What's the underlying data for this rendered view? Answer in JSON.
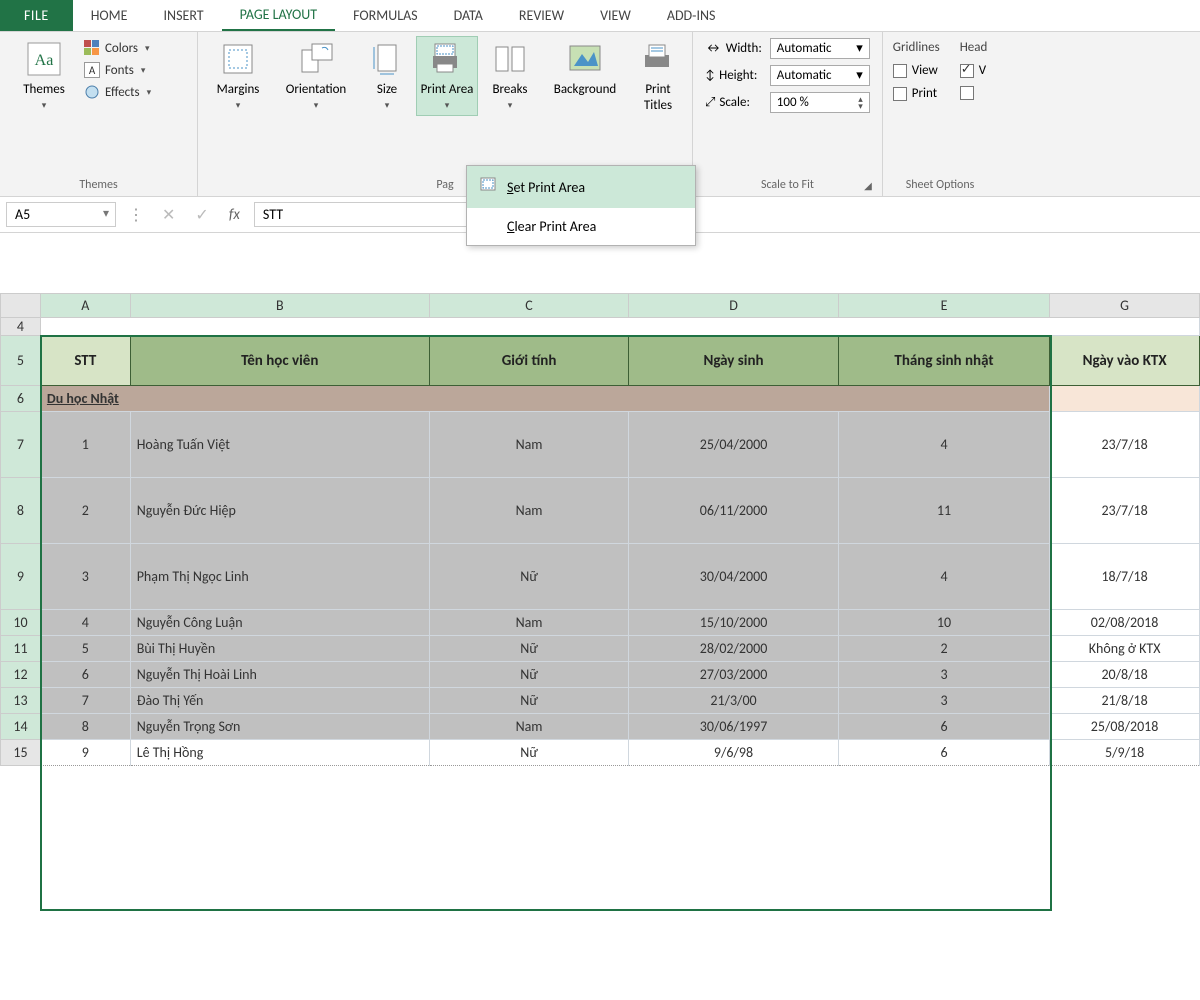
{
  "tabs": {
    "file": "FILE",
    "home": "HOME",
    "insert": "INSERT",
    "page_layout": "PAGE LAYOUT",
    "formulas": "FORMULAS",
    "data": "DATA",
    "review": "REVIEW",
    "view": "VIEW",
    "addins": "ADD-INS"
  },
  "ribbon": {
    "themes": {
      "label": "Themes",
      "btn": "Themes",
      "colors": "Colors",
      "fonts": "Fonts",
      "effects": "Effects"
    },
    "pagesetup": {
      "margins": "Margins",
      "orientation": "Orientation",
      "size": "Size",
      "printarea": "Print Area",
      "breaks": "Breaks",
      "background": "Background",
      "printtitles": "Print Titles",
      "label": "Page Setup",
      "label_trunc": "Pag"
    },
    "scale": {
      "label": "Scale to Fit",
      "width": "Width:",
      "height": "Height:",
      "scale": "Scale:",
      "auto": "Automatic",
      "scale_val": "100 %"
    },
    "sheetopts": {
      "label": "Sheet Options",
      "gridlines": "Gridlines",
      "headings": "Head",
      "view": "View",
      "print": "Print",
      "vtrunc": "V"
    }
  },
  "menu": {
    "set_s": "S",
    "set_rest": "et Print Area",
    "clear_c": "C",
    "clear_rest": "lear Print Area"
  },
  "formula_bar": {
    "namebox": "A5",
    "fx_value": "STT"
  },
  "columns": {
    "A": "A",
    "B": "B",
    "C": "C",
    "D": "D",
    "E": "E",
    "G": "G"
  },
  "row_numbers": [
    "4",
    "5",
    "6",
    "7",
    "8",
    "9",
    "10",
    "11",
    "12",
    "13",
    "14",
    "15"
  ],
  "headers": {
    "stt": "STT",
    "ten": "Tên học viên",
    "gioitinh": "Giới tính",
    "ngaysinh": "Ngày sinh",
    "thang": "Tháng sinh nhật",
    "ktx": "Ngày vào KTX"
  },
  "row6": "Du học Nhật",
  "rows": [
    {
      "stt": "1",
      "ten": "Hoàng Tuấn Việt",
      "gt": "Nam",
      "ns": "25/04/2000",
      "th": "4",
      "ktx": "23/7/18"
    },
    {
      "stt": "2",
      "ten": "Nguyễn Đức Hiệp",
      "gt": "Nam",
      "ns": "06/11/2000",
      "th": "11",
      "ktx": "23/7/18"
    },
    {
      "stt": "3",
      "ten": "Phạm Thị Ngọc Linh",
      "gt": "Nữ",
      "ns": "30/04/2000",
      "th": "4",
      "ktx": "18/7/18"
    },
    {
      "stt": "4",
      "ten": "Nguyễn Công Luận",
      "gt": "Nam",
      "ns": "15/10/2000",
      "th": "10",
      "ktx": "02/08/2018"
    },
    {
      "stt": "5",
      "ten": "Bùi Thị Huyền",
      "gt": "Nữ",
      "ns": "28/02/2000",
      "th": "2",
      "ktx": "Không ở KTX"
    },
    {
      "stt": "6",
      "ten": "Nguyễn Thị Hoài Linh",
      "gt": "Nữ",
      "ns": "27/03/2000",
      "th": "3",
      "ktx": "20/8/18"
    },
    {
      "stt": "7",
      "ten": "Đào Thị Yến",
      "gt": "Nữ",
      "ns": "21/3/00",
      "th": "3",
      "ktx": "21/8/18"
    },
    {
      "stt": "8",
      "ten": "Nguyễn Trọng Sơn",
      "gt": "Nam",
      "ns": "30/06/1997",
      "th": "6",
      "ktx": "25/08/2018"
    },
    {
      "stt": "9",
      "ten": "Lê Thị Hồng",
      "gt": "Nữ",
      "ns": "9/6/98",
      "th": "6",
      "ktx": "5/9/18"
    }
  ]
}
